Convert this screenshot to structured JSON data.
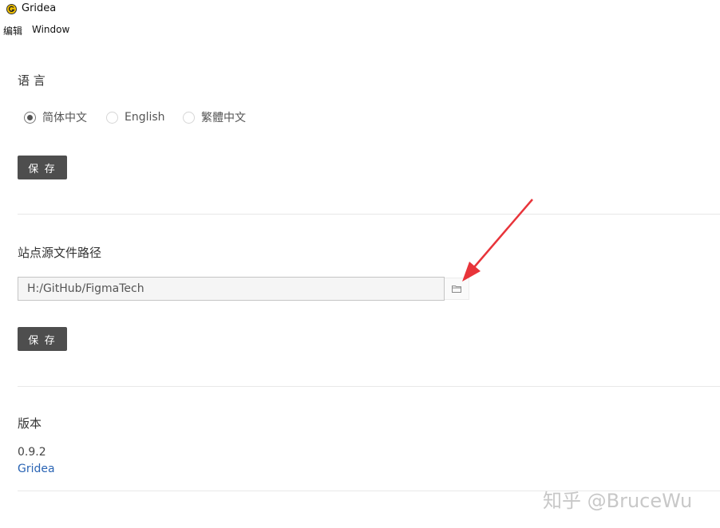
{
  "window": {
    "title": "Gridea"
  },
  "menubar": {
    "items": [
      {
        "label": "编辑"
      },
      {
        "label": "Window"
      }
    ]
  },
  "language": {
    "title": "语 言",
    "options": [
      {
        "label": "简体中文",
        "checked": true
      },
      {
        "label": "English",
        "checked": false
      },
      {
        "label": "繁體中文",
        "checked": false
      }
    ],
    "save_label": "保 存"
  },
  "source_path": {
    "title": "站点源文件路径",
    "value": "H:/GitHub/FigmaTech",
    "save_label": "保 存"
  },
  "version": {
    "title": "版本",
    "number": "0.9.2",
    "link_label": "Gridea"
  },
  "watermark": "知乎 @BruceWu",
  "colors": {
    "button_bg": "#4e4e4e",
    "link": "#2a64b4",
    "arrow": "#e8343a"
  }
}
